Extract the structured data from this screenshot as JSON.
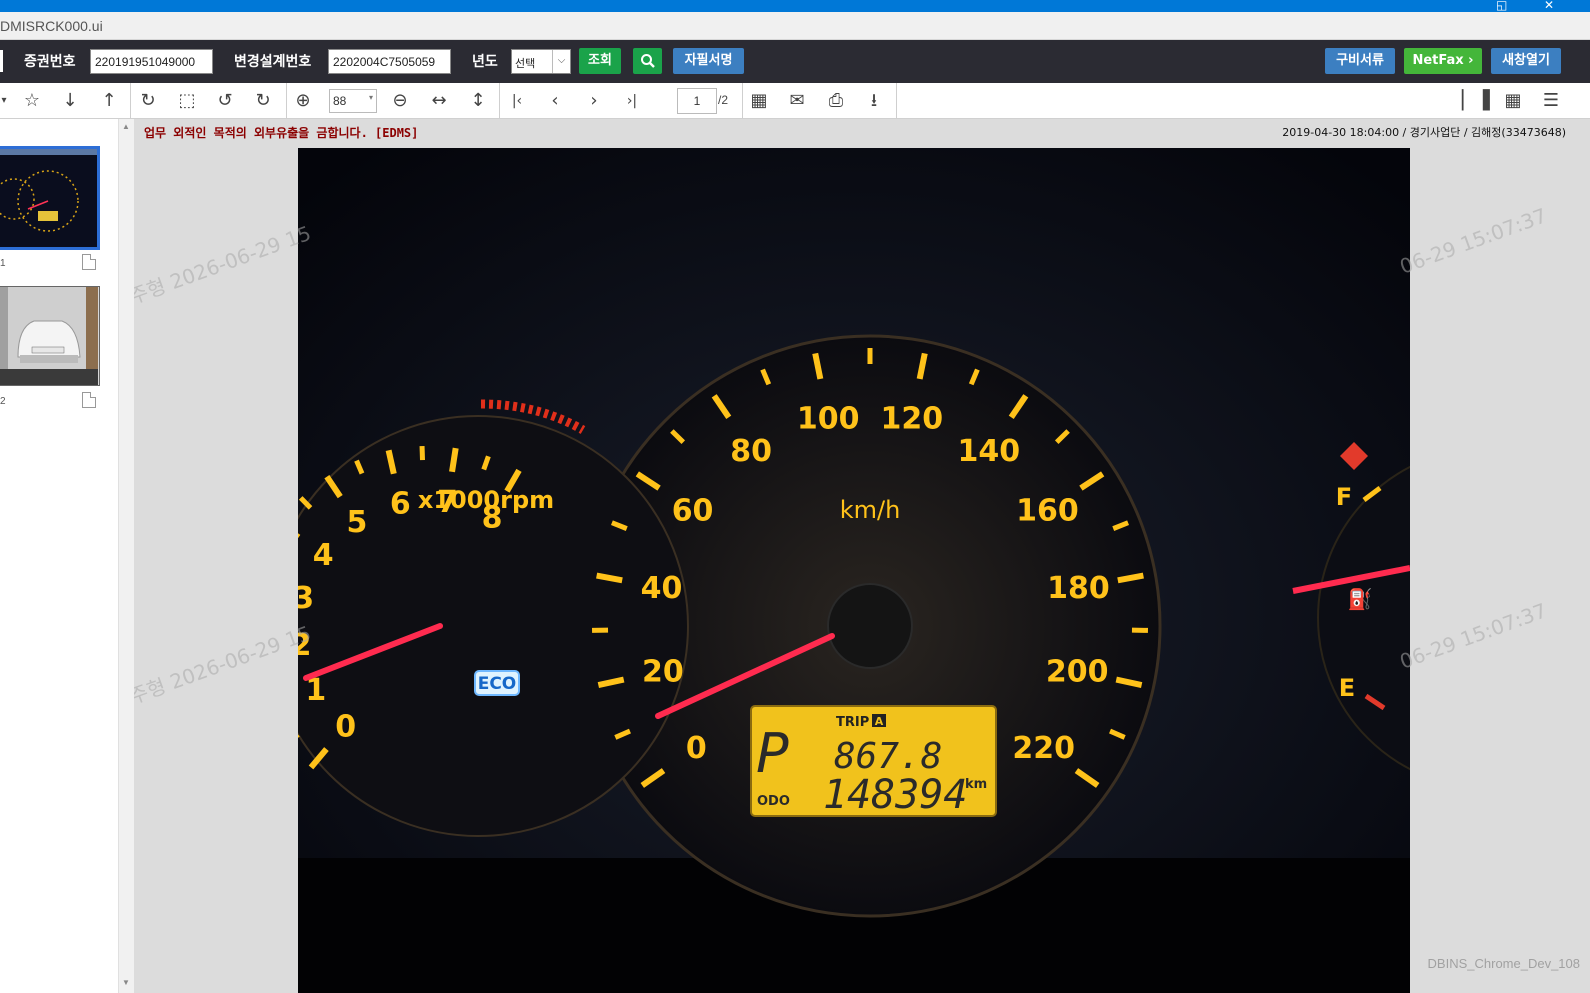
{
  "window": {
    "url_fragment": "DMISRCK000.ui"
  },
  "search": {
    "policy_label": "증권번호",
    "policy_value": "220191951049000",
    "change_label": "변경설계번호",
    "change_value": "2202004C7505059",
    "year_label": "년도",
    "year_selected": "선택",
    "query_button": "조회",
    "signature_button": "자필서명",
    "docs_button": "구비서류",
    "netfax_button": "NetFax",
    "newwin_button": "새창열기"
  },
  "toolbar": {
    "zoom_value": "88",
    "current_page": "1",
    "total_pages": "/2"
  },
  "thumbnails": [
    {
      "number": "1",
      "kind": "dashboard"
    },
    {
      "number": "2",
      "kind": "car"
    }
  ],
  "viewer": {
    "notice": "업무 외적인 목적의 외부유출을 금합니다. [EDMS]",
    "meta": "2019-04-30 18:04:00 / 경기사업단 / 김해정(33473648)",
    "watermark_left": "주형 2026-06-29 15",
    "watermark_right": "06-29 15:07:37",
    "dev_label": "DBINS_Chrome_Dev_108"
  },
  "gauge": {
    "rpm_labels": [
      "0",
      "1",
      "2",
      "3",
      "4",
      "5",
      "6",
      "7",
      "8"
    ],
    "rpm_unit": "x1000rpm",
    "speed_labels": [
      "0",
      "20",
      "40",
      "60",
      "80",
      "100",
      "120",
      "140",
      "160",
      "180",
      "200",
      "220"
    ],
    "speed_unit": "km/h",
    "eco": "ECO",
    "trip_label": "TRIP",
    "trip_letter": "A",
    "gear": "P",
    "trip_value": "867.8",
    "odo_label": "ODO",
    "odo_value": "148394",
    "odo_unit": "km",
    "fuel_full": "F",
    "fuel_empty": "E"
  },
  "colors": {
    "accent_blue": "#0078d7",
    "gauge_amber": "#ffc21a",
    "needle_red": "#ff2b4f"
  }
}
